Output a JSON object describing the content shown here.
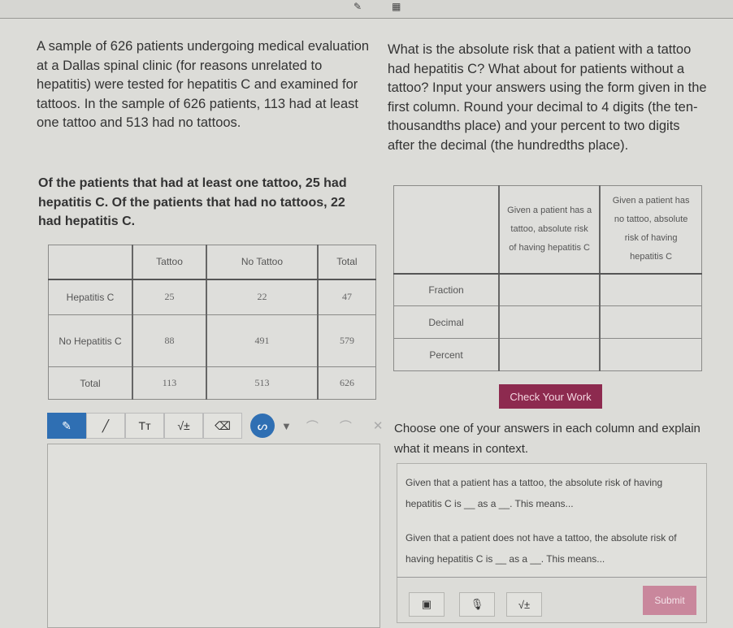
{
  "topbar": {
    "icons": [
      "pencil-icon",
      "calculator-icon"
    ],
    "pencil_glyph": "✎",
    "calc_glyph": "▦"
  },
  "problem": {
    "intro": "A sample of 626 patients undergoing medical evaluation at a Dallas spinal clinic (for reasons unrelated to hepatitis) were tested for hepatitis C and examined for tattoos.  In the sample of 626 patients, 113 had at least one tattoo and 513 had no tattoos.",
    "detail": "Of the patients that had at least one tattoo, 25 had hepatitis C.  Of the patients that had no tattoos, 22 had hepatitis C.",
    "question": "What is the absolute risk that a patient with a tattoo had hepatitis C? What about for patients without a tattoo? Input your answers using the form given in the first column. Round your decimal to 4 digits (the ten-thousandths place) and your percent to two digits after the decimal (the hundredths place)."
  },
  "contingency_table": {
    "headers": [
      "",
      "Tattoo",
      "No Tattoo",
      "Total"
    ],
    "rows": [
      {
        "label": "Hepatitis C",
        "values": [
          "25",
          "22",
          "47"
        ]
      },
      {
        "label": "No Hepatitis C",
        "values": [
          "88",
          "491",
          "579"
        ]
      },
      {
        "label": "Total",
        "values": [
          "113",
          "513",
          "626"
        ]
      }
    ]
  },
  "risk_table": {
    "headers": [
      "",
      "Given a patient has a tattoo, absolute risk of having hepatitis C",
      "Given a patient has no tattoo, absolute risk of having hepatitis C"
    ],
    "rows": [
      {
        "label": "Fraction",
        "values": [
          "",
          ""
        ]
      },
      {
        "label": "Decimal",
        "values": [
          "",
          ""
        ]
      },
      {
        "label": "Percent",
        "values": [
          "",
          ""
        ]
      }
    ]
  },
  "check_button": "Check Your Work",
  "drawing_toolbar": {
    "tools": [
      {
        "name": "pen-tool",
        "glyph": "✎"
      },
      {
        "name": "line-tool",
        "glyph": "╱"
      },
      {
        "name": "text-tool",
        "glyph": "Tт"
      },
      {
        "name": "math-tool",
        "glyph": "√±"
      },
      {
        "name": "eraser-tool",
        "glyph": "⌫"
      }
    ],
    "stroke_glyph": "ᔕ",
    "dropdown_glyph": "▼",
    "undo_glyph": "⌒",
    "redo_glyph": "⌒",
    "clear_glyph": "✕"
  },
  "explain": {
    "prompt": "Choose one of your answers in each column and explain what it means in context.",
    "line1": "Given that a patient has a tattoo, the absolute risk of having hepatitis C is __ as a __. This means...",
    "line2": "Given that a patient does not have a tattoo, the absolute risk of having hepatitis C is __ as a __. This means...",
    "image_glyph": "▣",
    "mic_glyph": "🎙",
    "math_glyph": "√±",
    "submit": "Submit"
  },
  "colors": {
    "accent_blue": "#2f6fb3",
    "check_button": "#8d2a4f",
    "submit_disabled": "#c9879c"
  }
}
